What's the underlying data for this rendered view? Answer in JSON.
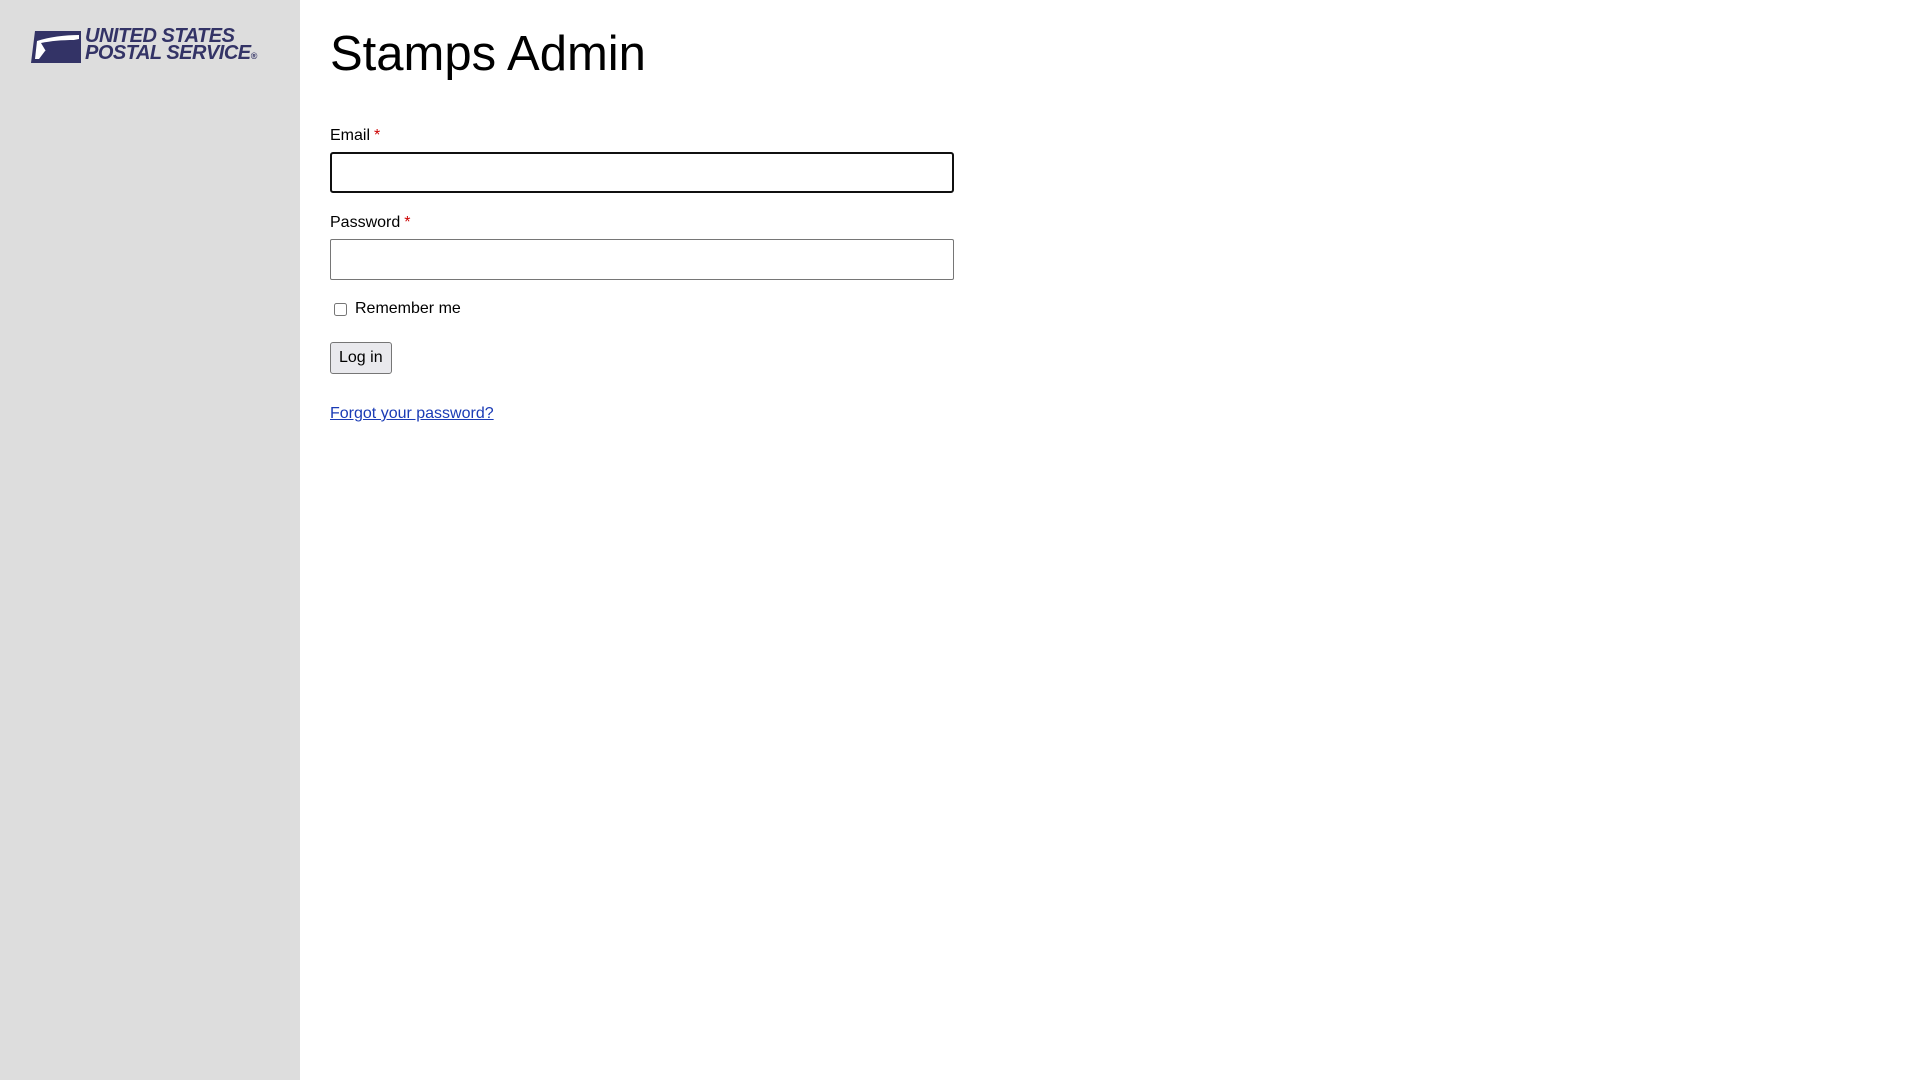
{
  "brand": {
    "logo_line1": "UNITED STATES",
    "logo_line2": "POSTAL SERVICE",
    "logo_registered": "®",
    "logo_color": "#333366"
  },
  "page": {
    "title": "Stamps Admin"
  },
  "form": {
    "email_label": "Email",
    "email_value": "",
    "password_label": "Password",
    "password_value": "",
    "required_marker": "*",
    "remember_label": "Remember me",
    "remember_checked": false,
    "submit_label": "Log in",
    "forgot_link": "Forgot your password?"
  },
  "colors": {
    "sidebar_bg": "#dddddd",
    "required": "#cc0000",
    "link": "#1a3bb5"
  }
}
